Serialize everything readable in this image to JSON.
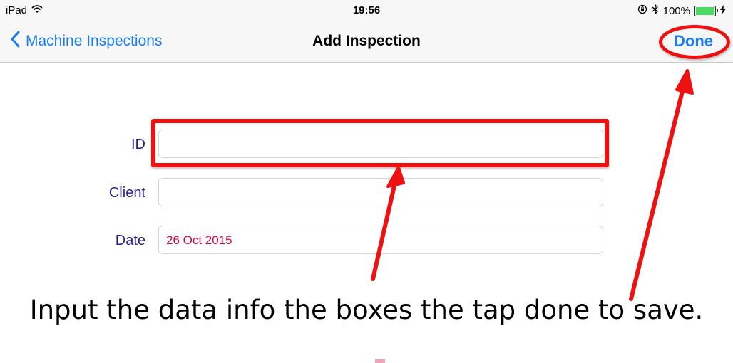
{
  "status_bar": {
    "device": "iPad",
    "time": "19:56",
    "battery": "100%",
    "battery_level": 1.0
  },
  "nav": {
    "back_label": "Machine Inspections",
    "title": "Add Inspection",
    "done_label": "Done"
  },
  "form": {
    "id_label": "ID",
    "id_value": "",
    "client_label": "Client",
    "client_value": "",
    "date_label": "Date",
    "date_value": "26 Oct 2015"
  },
  "annotation": {
    "instruction": "Input the data info the boxes the tap done to save.",
    "color": "#ee1111"
  },
  "colors": {
    "ios_blue": "#1a7cf4",
    "label_purple": "#2a1f8f",
    "date_red": "#e0003a"
  },
  "icons": {
    "wifi": "wifi-icon",
    "orientation_lock": "orientation-lock-icon",
    "bluetooth": "bluetooth-icon",
    "battery": "battery-icon",
    "charging": "charging-bolt-icon",
    "back": "chevron-left-icon"
  }
}
